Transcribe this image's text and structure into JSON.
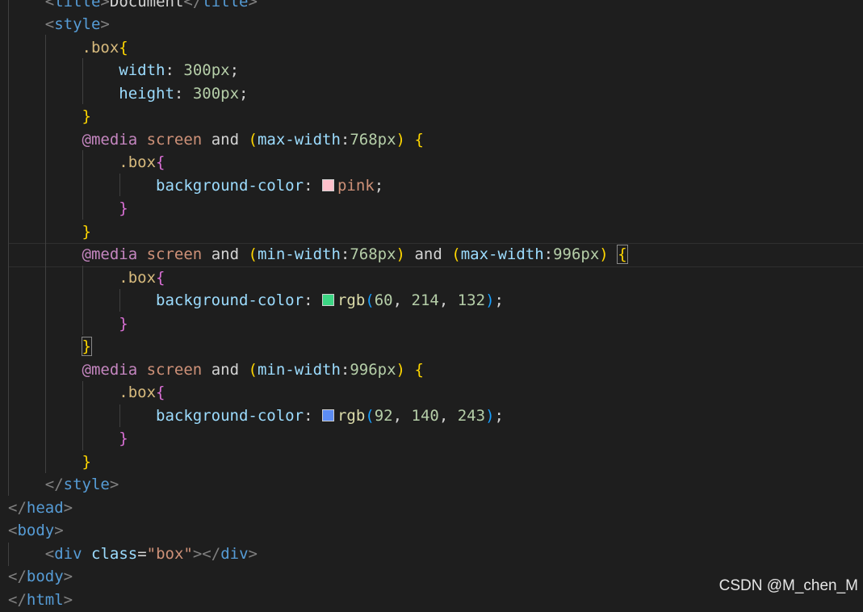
{
  "code": {
    "title_open_tag": "title",
    "title_text": "Document",
    "title_close_tag": "title",
    "style_tag": "style",
    "box_selector": ".box",
    "width_prop": "width",
    "width_value": "300px",
    "height_prop": "height",
    "height_value": "300px",
    "media_keyword": "@media",
    "screen_keyword": "screen",
    "and_keyword": "and",
    "max_width_prop": "max-width",
    "min_width_prop": "min-width",
    "v768": "768px",
    "v996": "996px",
    "bg_prop": "background-color",
    "pink_value": "pink",
    "rgb_fn": "rgb",
    "green_r": "60",
    "green_g": "214",
    "green_b": "132",
    "blue_r": "92",
    "blue_g": "140",
    "blue_b": "243",
    "head_tag": "head",
    "body_tag": "body",
    "div_tag": "div",
    "class_attr": "class",
    "class_value": "\"box\""
  },
  "swatches": {
    "pink": "#ffc0cb",
    "green": "#3cd684",
    "blue": "#5c8cf3"
  },
  "watermark": "CSDN @M_chen_M"
}
